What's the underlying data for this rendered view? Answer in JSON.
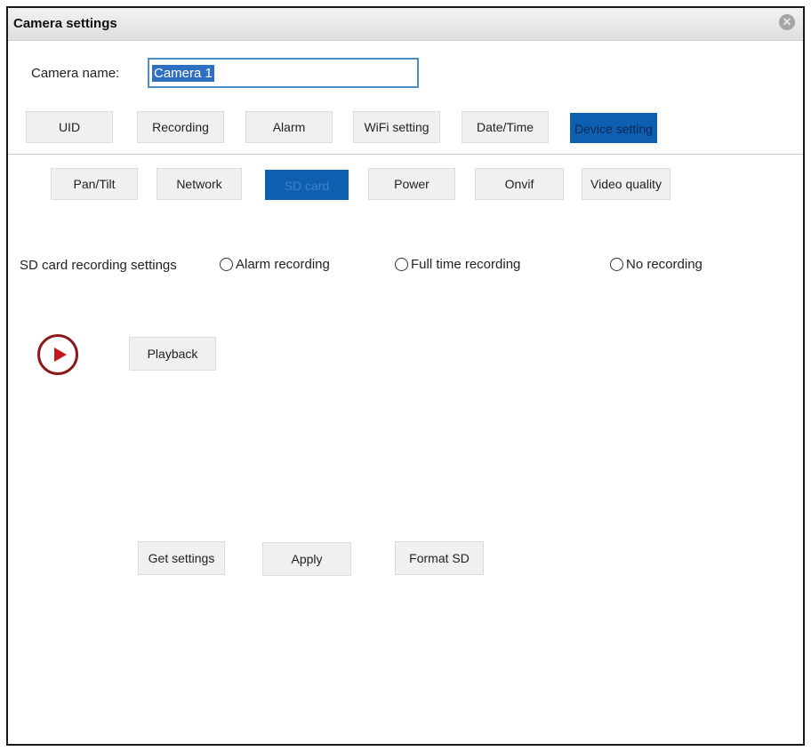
{
  "window": {
    "title": "Camera settings",
    "close_icon": "close-icon"
  },
  "camera_name": {
    "label": "Camera name:",
    "value": "Camera 1"
  },
  "tabs": [
    {
      "label": "UID",
      "active": false
    },
    {
      "label": "Recording",
      "active": false
    },
    {
      "label": "Alarm",
      "active": false
    },
    {
      "label": "WiFi setting",
      "active": false
    },
    {
      "label": "Date/Time",
      "active": false
    },
    {
      "label": "Device setting",
      "active": true
    }
  ],
  "subtabs": [
    {
      "label": "Pan/Tilt",
      "active": false
    },
    {
      "label": "Network",
      "active": false
    },
    {
      "label": "SD card",
      "active": true
    },
    {
      "label": "Power",
      "active": false
    },
    {
      "label": "Onvif",
      "active": false
    },
    {
      "label": "Video quality",
      "active": false
    }
  ],
  "sd_recording": {
    "label": "SD card recording settings",
    "options": [
      "Alarm recording",
      "Full time recording",
      "No recording"
    ]
  },
  "playback": {
    "label": "Playback",
    "icon": "play-icon"
  },
  "actions": {
    "get_settings": "Get settings",
    "apply": "Apply",
    "format_sd": "Format SD"
  },
  "colors": {
    "accent": "#0f5fb0",
    "play_icon": "#c41919"
  }
}
